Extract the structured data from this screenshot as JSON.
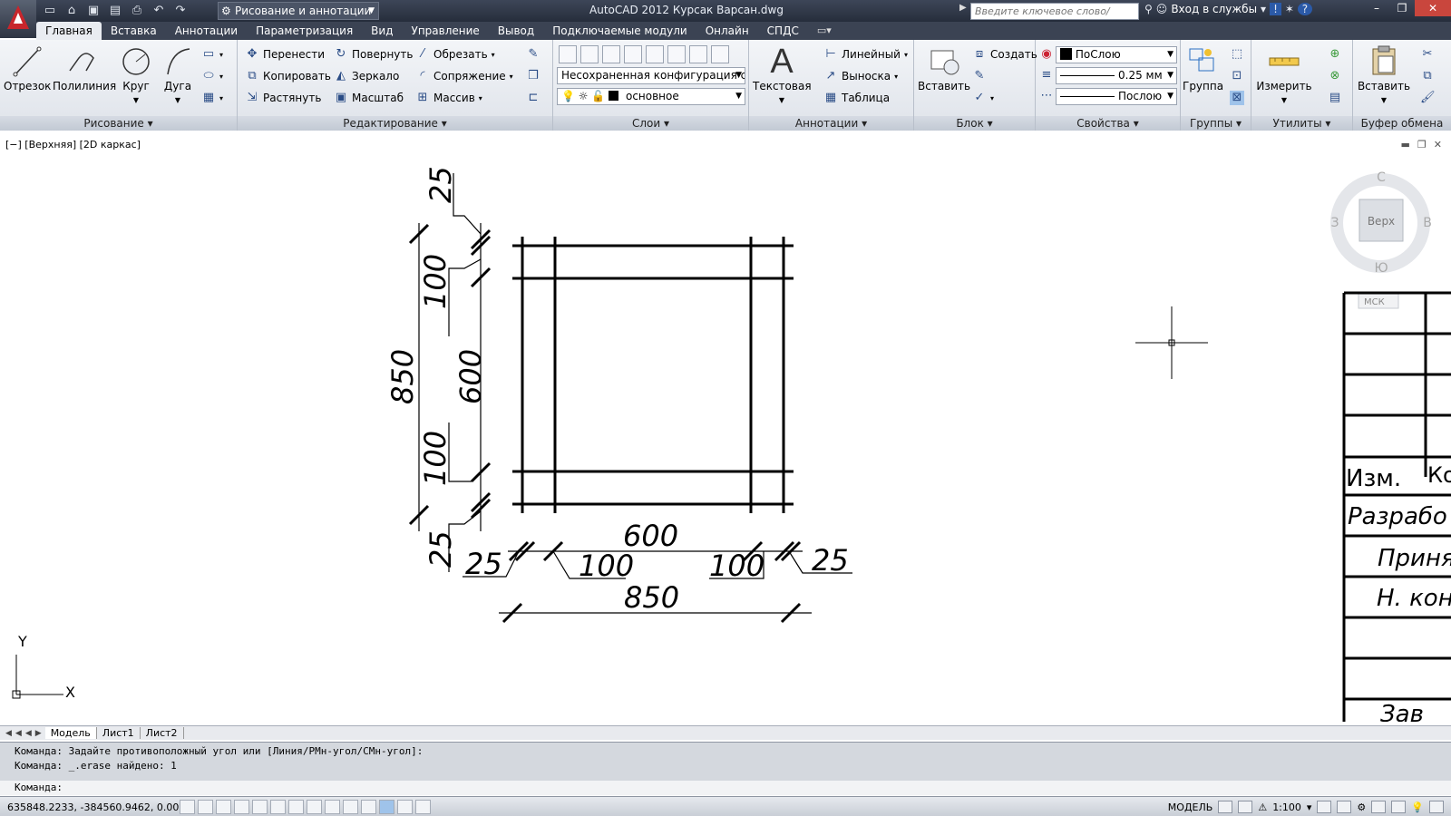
{
  "title_bar": {
    "workspace": "Рисование и аннотации",
    "title": "AutoCAD 2012   Курсак Варсан.dwg",
    "search_placeholder": "Введите ключевое слово/фразу",
    "signin": "Вход в службы"
  },
  "tabs": [
    "Главная",
    "Вставка",
    "Аннотации",
    "Параметризация",
    "Вид",
    "Управление",
    "Вывод",
    "Подключаемые модули",
    "Онлайн",
    "СПДС"
  ],
  "ribbon": {
    "draw": {
      "title": "Рисование",
      "line": "Отрезок",
      "polyline": "Полилиния",
      "circle": "Круг",
      "arc": "Дуга"
    },
    "modify": {
      "title": "Редактирование",
      "move": "Перенести",
      "rotate": "Повернуть",
      "trim": "Обрезать",
      "copy": "Копировать",
      "mirror": "Зеркало",
      "fillet": "Сопряжение",
      "stretch": "Растянуть",
      "scale": "Масштаб",
      "array": "Массив"
    },
    "layers": {
      "title": "Слои",
      "config": "Несохраненная конфигурация сло",
      "current": "основное"
    },
    "annotation": {
      "title": "Аннотации",
      "text": "Текстовая",
      "linear": "Линейный",
      "leader": "Выноска",
      "table": "Таблица"
    },
    "block": {
      "title": "Блок",
      "insert": "Вставить",
      "create": "Создать"
    },
    "properties": {
      "title": "Свойства",
      "color": "ПоСлою",
      "lineweight": "0.25 мм",
      "linetype": "Послою"
    },
    "groups": {
      "title": "Группы",
      "group": "Группа"
    },
    "utilities": {
      "title": "Утилиты",
      "measure": "Измерить"
    },
    "clipboard": {
      "title": "Буфер обмена",
      "paste": "Вставить"
    }
  },
  "viewport": {
    "label": "[−] [Верхняя] [2D каркас]",
    "viewcube": {
      "face": "Верх",
      "n": "С",
      "s": "Ю",
      "w": "З",
      "e": "В",
      "ucs": "МСК"
    }
  },
  "dimensions": {
    "left_total": "850",
    "left_top": "25",
    "left_100a": "100",
    "left_mid": "600",
    "left_100b": "100",
    "left_bottom": "25",
    "bottom_mid": "600",
    "bottom_25a": "25",
    "bottom_100a": "100",
    "bottom_100b": "100",
    "bottom_25b": "25",
    "bottom_total": "850"
  },
  "title_block": {
    "izm": "Изм.",
    "ko": "Ко",
    "razrab": "Разрабо",
    "prinyal": "Приня",
    "nkon": "Н.  кон",
    "zav": "Зав"
  },
  "layout_tabs": [
    "Модель",
    "Лист1",
    "Лист2"
  ],
  "command": {
    "line1": "Команда: Задайте противоположный угол или [Линия/РМн-угол/СМн-угол]:",
    "line2": "Команда: _.erase найдено: 1",
    "prompt": "Команда:"
  },
  "status": {
    "coords": "635848.2233, -384560.9462, 0.0000",
    "model": "МОДЕЛЬ",
    "scale": "1:100"
  }
}
